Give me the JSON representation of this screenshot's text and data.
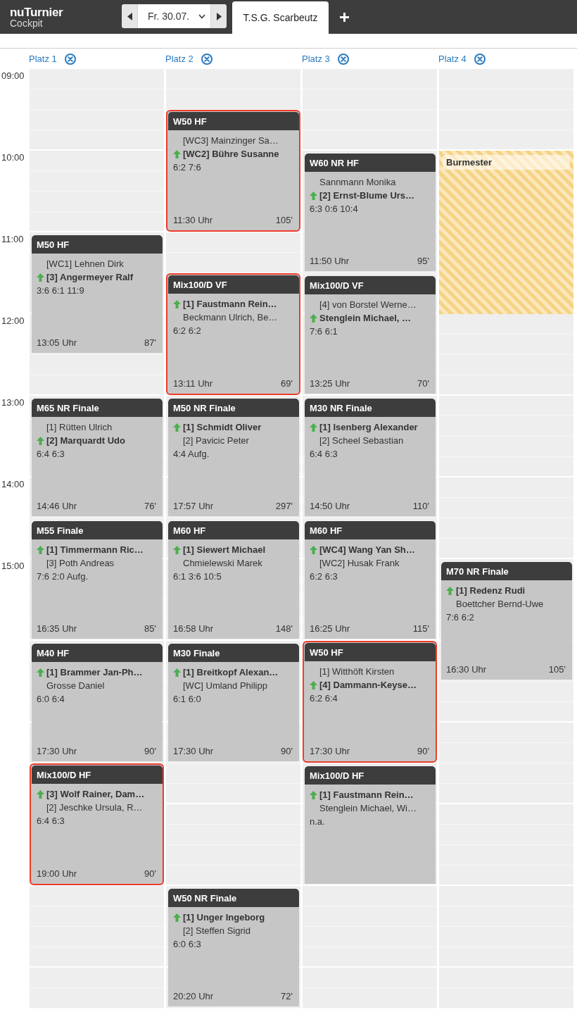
{
  "app": {
    "name": "nuTurnier",
    "subtitle": "Cockpit"
  },
  "date_picker": {
    "value": "Fr. 30.07."
  },
  "tabs": [
    {
      "label": "T.S.G. Scarbeutz",
      "selected": true
    }
  ],
  "time_labels": [
    "09:00",
    "10:00",
    "11:00",
    "12:00",
    "13:00",
    "14:00",
    "15:00"
  ],
  "courts": [
    {
      "name": "Platz 1",
      "entries": [
        {
          "kind": "match",
          "title": "M50 HF",
          "highlighted": false,
          "players": [
            {
              "name": "[WC1] Lehnen Dirk",
              "winner": false
            },
            {
              "name": "[3] Angermeyer Ralf",
              "winner": true
            }
          ],
          "score": "3:6 6:1 11:9",
          "end_time": "13:05 Uhr",
          "duration": "87'"
        },
        {
          "kind": "match",
          "title": "M65 NR Finale",
          "highlighted": false,
          "players": [
            {
              "name": "[1] Rütten Ulrich",
              "winner": false
            },
            {
              "name": "[2] Marquardt Udo",
              "winner": true
            }
          ],
          "score": "6:4 6:3",
          "end_time": "14:46 Uhr",
          "duration": "76'"
        },
        {
          "kind": "match",
          "title": "M55 Finale",
          "highlighted": false,
          "players": [
            {
              "name": "[1] Timmermann Ric…",
              "winner": true
            },
            {
              "name": "[3] Poth Andreas",
              "winner": false
            }
          ],
          "score": "7:6 2:0 Aufg.",
          "end_time": "16:35 Uhr",
          "duration": "85'"
        },
        {
          "kind": "match",
          "title": "M40 HF",
          "highlighted": false,
          "players": [
            {
              "name": "[1] Brammer Jan-Ph…",
              "winner": true
            },
            {
              "name": "Grosse Daniel",
              "winner": false
            }
          ],
          "score": "6:0 6:4",
          "end_time": "17:30 Uhr",
          "duration": "90'"
        },
        {
          "kind": "match",
          "title": "Mix100/D HF",
          "highlighted": true,
          "players": [
            {
              "name": "[3] Wolf Rainer, Dam…",
              "winner": true
            },
            {
              "name": "[2] Jeschke Ursula, R…",
              "winner": false
            }
          ],
          "score": "6:4 6:3",
          "end_time": "19:00 Uhr",
          "duration": "90'"
        }
      ]
    },
    {
      "name": "Platz 2",
      "entries": [
        {
          "kind": "match",
          "title": "W50 HF",
          "highlighted": true,
          "players": [
            {
              "name": "[WC3] Mainzinger Sa…",
              "winner": false
            },
            {
              "name": "[WC2] Bühre Susanne",
              "winner": true
            }
          ],
          "score": "6:2 7:6",
          "end_time": "11:30 Uhr",
          "duration": "105'"
        },
        {
          "kind": "match",
          "title": "Mix100/D VF",
          "highlighted": true,
          "players": [
            {
              "name": "[1] Faustmann Rein…",
              "winner": true
            },
            {
              "name": "Beckmann Ulrich, Be…",
              "winner": false
            }
          ],
          "score": "6:2 6:2",
          "end_time": "13:11 Uhr",
          "duration": "69'"
        },
        {
          "kind": "match",
          "title": "M50 NR Finale",
          "highlighted": false,
          "players": [
            {
              "name": "[1] Schmidt Oliver",
              "winner": true
            },
            {
              "name": "[2] Pavicic Peter",
              "winner": false
            }
          ],
          "score": "4:4 Aufg.",
          "end_time": "17:57 Uhr",
          "duration": "297'"
        },
        {
          "kind": "match",
          "title": "M60 HF",
          "highlighted": false,
          "players": [
            {
              "name": "[1] Siewert Michael",
              "winner": true
            },
            {
              "name": "Chmielewski Marek",
              "winner": false
            }
          ],
          "score": "6:1 3:6 10:5",
          "end_time": "16:58 Uhr",
          "duration": "148'"
        },
        {
          "kind": "match",
          "title": "M30 Finale",
          "highlighted": false,
          "players": [
            {
              "name": "[1] Breitkopf Alexan…",
              "winner": true
            },
            {
              "name": "[WC] Umland Philipp",
              "winner": false
            }
          ],
          "score": "6:1 6:0",
          "end_time": "17:30 Uhr",
          "duration": "90'"
        },
        {
          "kind": "match",
          "title": "W50 NR Finale",
          "highlighted": false,
          "players": [
            {
              "name": "[1] Unger Ingeborg",
              "winner": true
            },
            {
              "name": "[2] Steffen Sigrid",
              "winner": false
            }
          ],
          "score": "6:0 6:3",
          "end_time": "20:20 Uhr",
          "duration": "72'"
        }
      ]
    },
    {
      "name": "Platz 3",
      "entries": [
        {
          "kind": "match",
          "title": "W60 NR HF",
          "highlighted": false,
          "players": [
            {
              "name": "Sannmann Monika",
              "winner": false
            },
            {
              "name": "[2] Ernst-Blume Urs…",
              "winner": true
            }
          ],
          "score": "6:3 0:6 10:4",
          "end_time": "11:50 Uhr",
          "duration": "95'"
        },
        {
          "kind": "match",
          "title": "Mix100/D VF",
          "highlighted": false,
          "players": [
            {
              "name": "[4] von Borstel Werne…",
              "winner": false
            },
            {
              "name": "Stenglein Michael, …",
              "winner": true
            }
          ],
          "score": "7:6 6:1",
          "end_time": "13:25 Uhr",
          "duration": "70'"
        },
        {
          "kind": "match",
          "title": "M30 NR Finale",
          "highlighted": false,
          "players": [
            {
              "name": "[1] Isenberg Alexander",
              "winner": true
            },
            {
              "name": "[2] Scheel Sebastian",
              "winner": false
            }
          ],
          "score": "6:4 6:3",
          "end_time": "14:50 Uhr",
          "duration": "110'"
        },
        {
          "kind": "match",
          "title": "M60 HF",
          "highlighted": false,
          "players": [
            {
              "name": "[WC4] Wang Yan Sh…",
              "winner": true
            },
            {
              "name": "[WC2] Husak Frank",
              "winner": false
            }
          ],
          "score": "6:2 6:3",
          "end_time": "16:25 Uhr",
          "duration": "115'"
        },
        {
          "kind": "match",
          "title": "W50 HF",
          "highlighted": true,
          "players": [
            {
              "name": "[1] Witthöft Kirsten",
              "winner": false
            },
            {
              "name": "[4] Dammann-Keyse…",
              "winner": true
            }
          ],
          "score": "6:2 6:4",
          "end_time": "17:30 Uhr",
          "duration": "90'"
        },
        {
          "kind": "match",
          "title": "Mix100/D HF",
          "highlighted": false,
          "players": [
            {
              "name": "[1] Faustmann Rein…",
              "winner": true
            },
            {
              "name": "Stenglein Michael, Wi…",
              "winner": false
            }
          ],
          "score": "n.a."
        }
      ]
    },
    {
      "name": "Platz 4",
      "entries": [
        {
          "kind": "reservation",
          "label": "Burmester"
        },
        {
          "kind": "match",
          "title": "M70 NR Finale",
          "highlighted": false,
          "players": [
            {
              "name": "[1] Redenz Rudi",
              "winner": true
            },
            {
              "name": "Boettcher Bernd-Uwe",
              "winner": false
            }
          ],
          "score": "7:6 6:2",
          "end_time": "16:30 Uhr",
          "duration": "105'"
        }
      ]
    }
  ]
}
